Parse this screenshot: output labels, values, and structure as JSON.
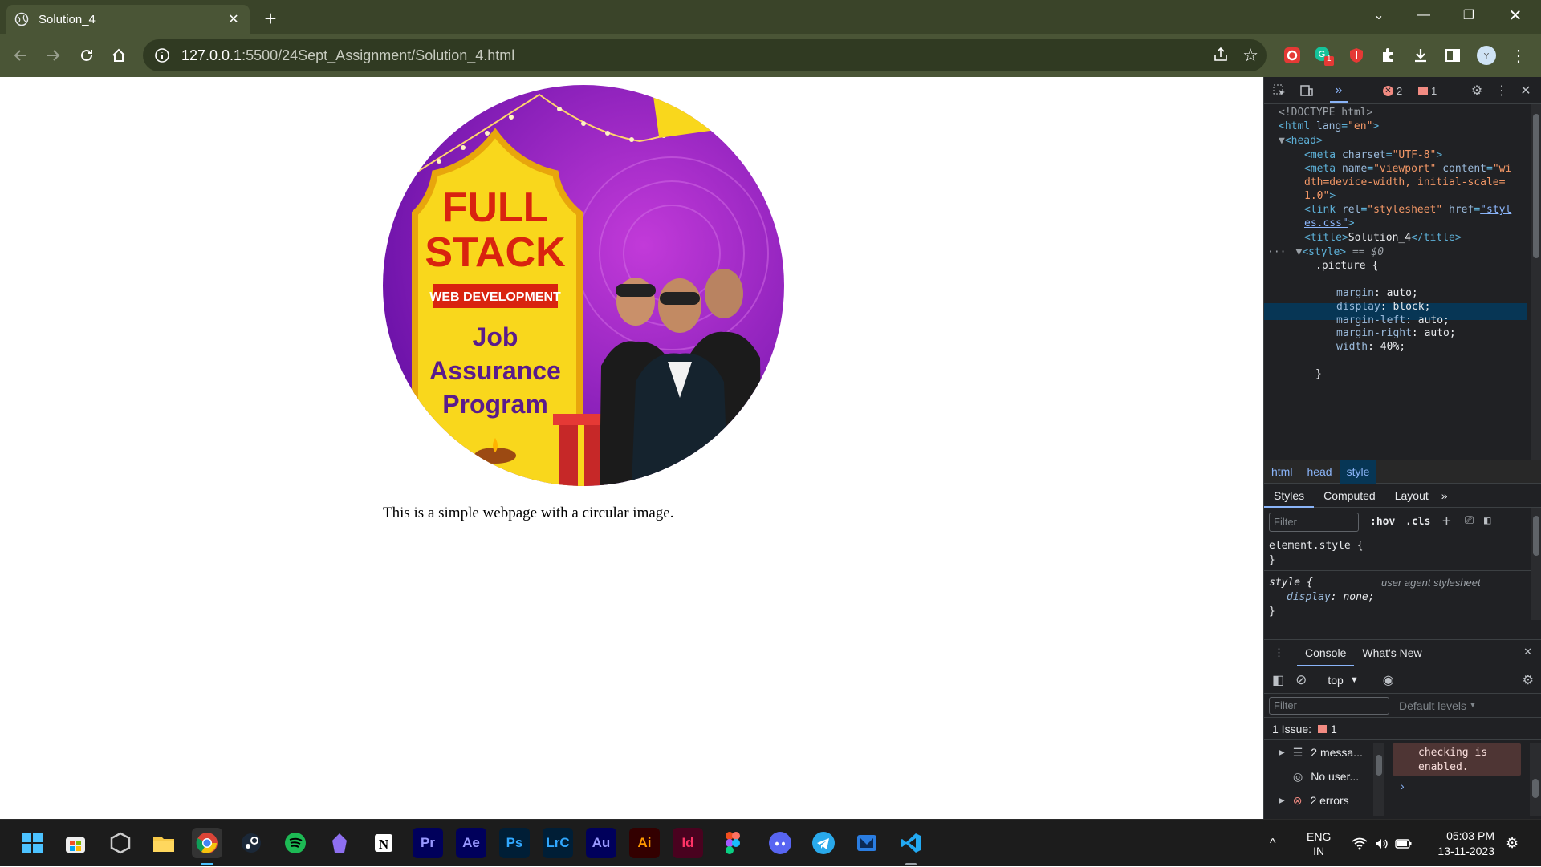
{
  "browser": {
    "tab_title": "Solution_4",
    "url_host": "127.0.0.1",
    "url_path": ":5500/24Sept_Assignment/Solution_4.html",
    "extension_badge": "1"
  },
  "page": {
    "image": {
      "headline_1": "FULL",
      "headline_2": "STACK",
      "ribbon": "WEB DEVELOPMENT",
      "line_1": "Job",
      "line_2": "Assurance",
      "line_3": "Program"
    },
    "paragraph": "This is a simple webpage with a circular image."
  },
  "devtools": {
    "error_count": "2",
    "warning_count": "1",
    "elements": {
      "doctype": "<!DOCTYPE html>",
      "html_open": "<html",
      "html_lang_attr": "lang",
      "html_lang_val": "\"en\"",
      "head": "<head>",
      "meta_charset_attr": "charset",
      "meta_charset_val": "\"UTF-8\"",
      "meta_name_attr": "name",
      "meta_name_val": "\"viewport\"",
      "meta_content_attr": "content",
      "meta_content_val_1": "\"wi",
      "meta_content_val_2": "dth=device-width, initial-scale=",
      "meta_content_val_3": "1.0\"",
      "link_rel_attr": "rel",
      "link_rel_val": "\"stylesheet\"",
      "link_href_attr": "href",
      "link_href_val_1": "\"styl",
      "link_href_val_2": "es.css\"",
      "title_text": "Solution_4",
      "style_selected": "== $0",
      "css_selector": ".picture {",
      "css_rules": [
        {
          "prop": "margin",
          "val": "auto;"
        },
        {
          "prop": "display",
          "val": "block;"
        },
        {
          "prop": "margin-left",
          "val": "auto;"
        },
        {
          "prop": "margin-right",
          "val": "auto;"
        },
        {
          "prop": "width",
          "val": "40%;"
        }
      ],
      "css_close": "}"
    },
    "breadcrumbs": [
      "html",
      "head",
      "style"
    ],
    "style_tabs": [
      "Styles",
      "Computed",
      "Layout"
    ],
    "styles": {
      "filter_placeholder": "Filter",
      "hov": ":hov",
      "cls": ".cls",
      "element_style": "element.style {",
      "close": "}",
      "style_selector": "style {",
      "ua_label": "user agent stylesheet",
      "ua_prop": "display",
      "ua_val": "none;"
    },
    "drawer_tabs": [
      "Console",
      "What's New"
    ],
    "console": {
      "context": "top",
      "filter_placeholder": "Filter",
      "levels": "Default levels",
      "issues_label": "1 Issue:",
      "issues_count": "1",
      "messages": [
        "2 messa...",
        "No user...",
        "2 errors"
      ],
      "right_message": "checking is enabled."
    }
  },
  "taskbar": {
    "apps": [
      "Pr",
      "Ae",
      "Ps",
      "LrC",
      "Au",
      "Ai",
      "Id"
    ],
    "lang_1": "ENG",
    "lang_2": "IN",
    "time": "05:03 PM",
    "date": "13-11-2023"
  },
  "colors": {
    "chrome_frame": "#3a4429",
    "chrome_toolbar": "#4a5536",
    "devtools_bg": "#202124",
    "purple": "#8b1fc4",
    "yellow": "#f9d71c"
  }
}
